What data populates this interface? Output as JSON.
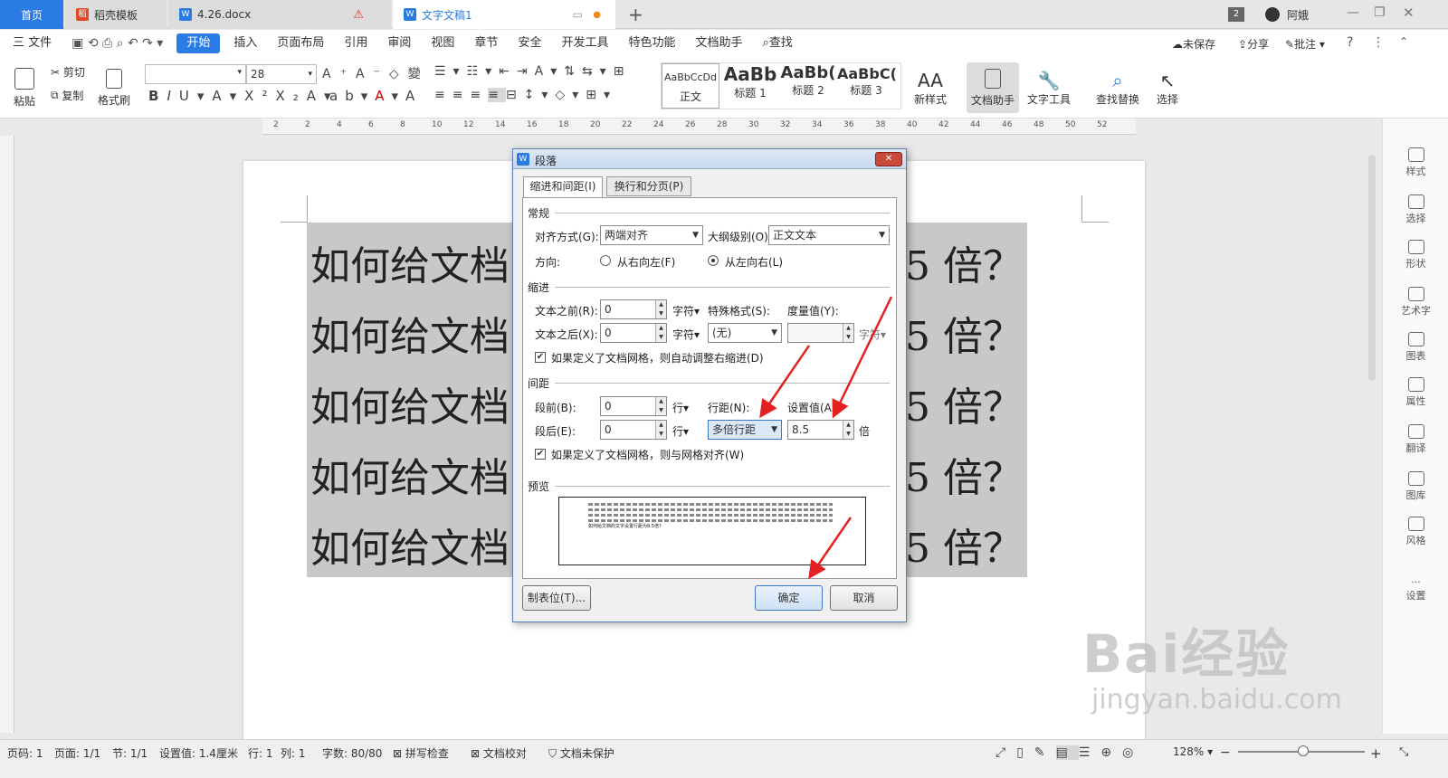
{
  "tabs": {
    "home": "首页",
    "t1": "稻壳模板",
    "t2": "4.26.docx",
    "t3": "文字文稿1",
    "plus": "+",
    "badge": "2",
    "user": "阿娥"
  },
  "menu": {
    "file": "三 文件",
    "items": [
      "开始",
      "插入",
      "页面布局",
      "引用",
      "审阅",
      "视图",
      "章节",
      "安全",
      "开发工具",
      "特色功能",
      "文档助手"
    ],
    "find": "查找",
    "right": [
      "未保存",
      "分享",
      "批注"
    ]
  },
  "ribbon": {
    "paste": "粘贴",
    "cut": "剪切",
    "copy": "复制",
    "format_painter": "格式刷",
    "font_size": "28",
    "styles": [
      {
        "preview": "AaBbCcDd",
        "name": "正文"
      },
      {
        "preview": "AaBb",
        "name": "标题 1"
      },
      {
        "preview": "AaBb(",
        "name": "标题 2"
      },
      {
        "preview": "AaBbC(",
        "name": "标题 3"
      }
    ],
    "new_style": "新样式",
    "doc_assistant": "文档助手",
    "text_tools": "文字工具",
    "find_replace": "查找替换",
    "select": "选择"
  },
  "document": {
    "line_start": "如何给文档",
    "line_end": "5 倍？",
    "lines": 5
  },
  "dialog": {
    "title": "段落",
    "tab_active": "缩进和间距(I)",
    "tab_other": "换行和分页(P)",
    "general": "常规",
    "align_label": "对齐方式(G):",
    "align_value": "两端对齐",
    "outline_label": "大纲级别(O):",
    "outline_value": "正文文本",
    "direction_label": "方向:",
    "rtl": "从右向左(F)",
    "ltr": "从左向右(L)",
    "indent": "缩进",
    "before_text_label": "文本之前(R):",
    "before_text_value": "0",
    "after_text_label": "文本之后(X):",
    "after_text_value": "0",
    "unit_char": "字符▾",
    "special_label": "特殊格式(S):",
    "special_value": "(无)",
    "measure_label": "度量值(Y):",
    "auto_indent": "如果定义了文档网格，则自动调整右缩进(D)",
    "spacing": "间距",
    "before_label": "段前(B):",
    "before_value": "0",
    "after_label": "段后(E):",
    "after_value": "0",
    "unit_line": "行▾",
    "line_spacing_label": "行距(N):",
    "line_spacing_value": "多倍行距",
    "set_value_label": "设置值(A):",
    "set_value": "8.5",
    "unit_times": "倍",
    "grid_align": "如果定义了文档网格，则与网格对齐(W)",
    "preview": "预览",
    "preview_text": "如何给文档的文字设置行距为8.5倍?",
    "tabs_button": "制表位(T)...",
    "ok": "确定",
    "cancel": "取消"
  },
  "right_panel": [
    "样式",
    "选择",
    "形状",
    "艺术字",
    "图表",
    "属性",
    "翻译",
    "图库",
    "风格",
    "设置"
  ],
  "status": {
    "page_num": "页码: 1",
    "page": "页面: 1/1",
    "section": "节: 1/1",
    "set_value": "设置值: 1.4厘米",
    "row": "行: 1",
    "col": "列: 1",
    "words": "字数: 80/80",
    "spell": "拼写检查",
    "proof": "文档校对",
    "protect": "文档未保护",
    "zoom": "128%"
  },
  "ruler_marks": [
    "2",
    "2",
    "4",
    "6",
    "8",
    "10",
    "12",
    "14",
    "16",
    "18",
    "20",
    "22",
    "24",
    "26",
    "28",
    "30",
    "32",
    "34",
    "36",
    "38",
    "40",
    "42",
    "44",
    "46",
    "48",
    "50",
    "52"
  ],
  "watermark": {
    "brand": "Bai经验",
    "url": "jingyan.baidu.com"
  },
  "colors": {
    "accent": "#2b7be5",
    "arrow": "#e52020",
    "selection": "#c8c8c8"
  }
}
